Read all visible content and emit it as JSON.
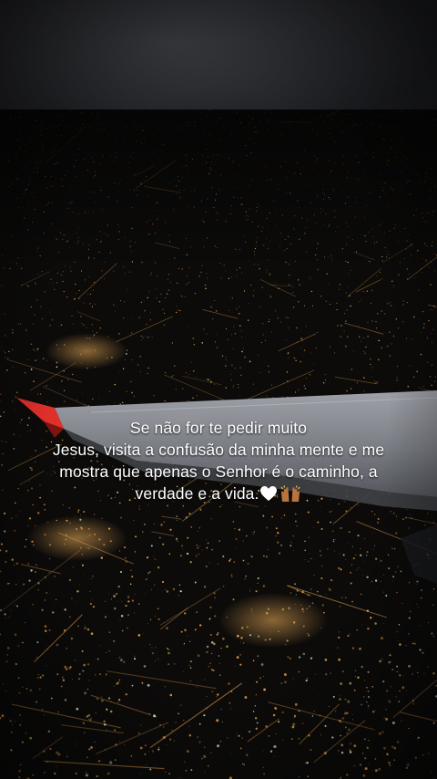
{
  "caption": {
    "lines": [
      "Se não for te pedir muito",
      "Jesus, visita a confusão da minha mente e me",
      "mostra que apenas o Senhor é o caminho, a",
      "verdade e a vida."
    ],
    "emojis": [
      "white-heart-icon",
      "raised-hands-icon"
    ]
  },
  "scene": {
    "description_icons": [
      "night-city-icon",
      "airplane-wing-icon"
    ],
    "colors": {
      "sky": "#2b2c30",
      "city_lights": "#f0a64a",
      "city_lights_cool": "#e8f0d2",
      "wing": "#8d9096",
      "wing_tip": "#e0302a",
      "text": "#ffffff"
    }
  }
}
